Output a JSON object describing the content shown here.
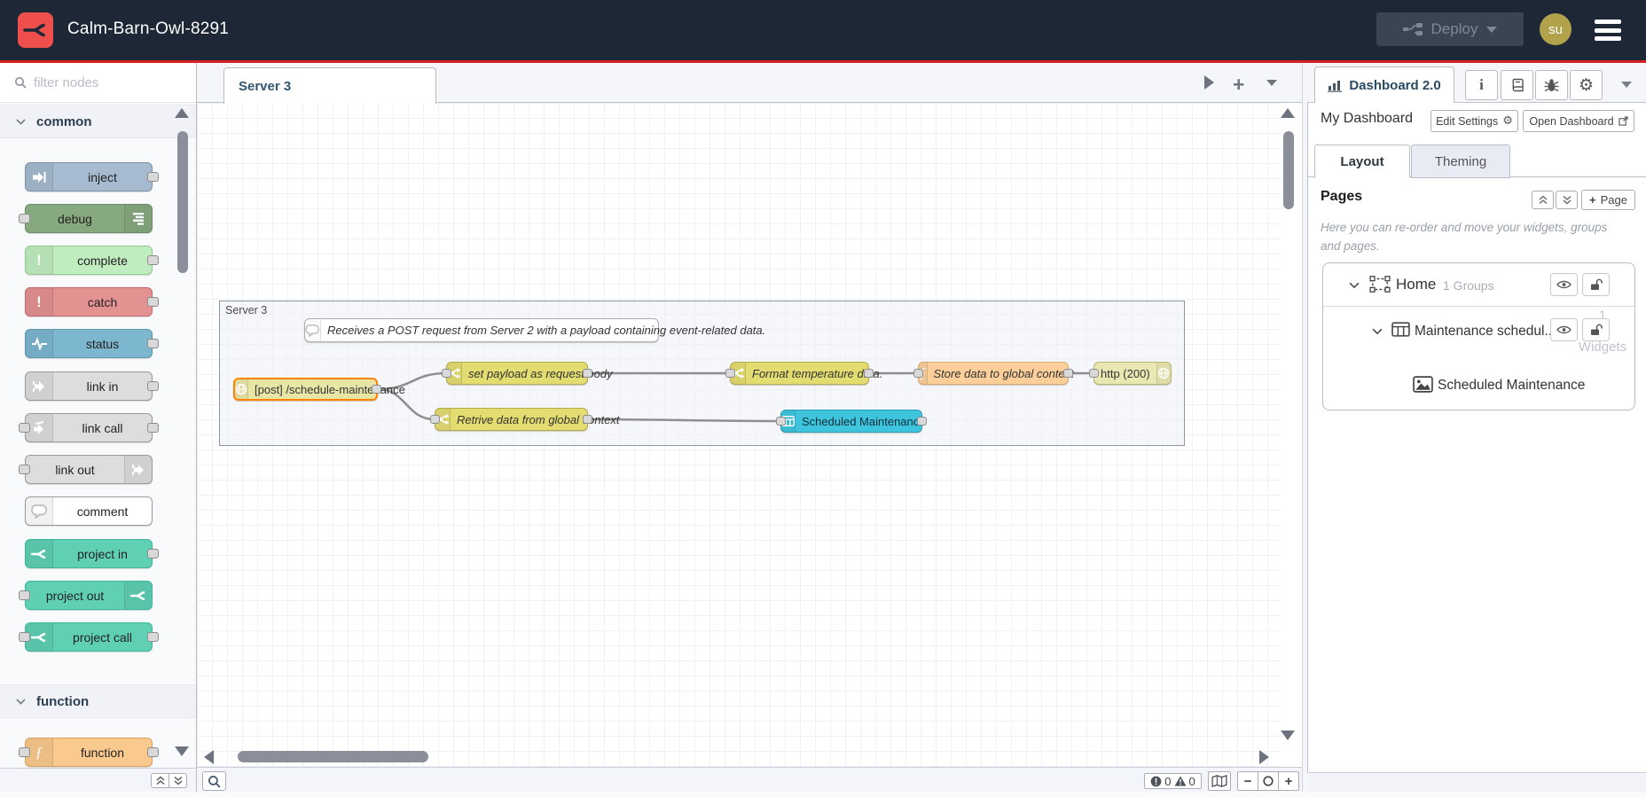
{
  "header": {
    "title": "Calm-Barn-Owl-8291",
    "deploy_label": "Deploy",
    "avatar_initials": "su"
  },
  "palette": {
    "filter_placeholder": "filter nodes",
    "categories": [
      {
        "label": "common",
        "items": [
          {
            "label": "inject",
            "color": "#a6bbcf",
            "icon": "inject-icon",
            "ports": "out"
          },
          {
            "label": "debug",
            "color": "#87a980",
            "icon": "debug-icon",
            "ports": "in"
          },
          {
            "label": "complete",
            "color": "#c0edc0",
            "icon": "exclamation-icon",
            "ports": "out"
          },
          {
            "label": "catch",
            "color": "#e49191",
            "icon": "exclamation-icon",
            "ports": "out"
          },
          {
            "label": "status",
            "color": "#7db7cf",
            "icon": "heartbeat-icon",
            "ports": "out"
          },
          {
            "label": "link in",
            "color": "#dddddd",
            "icon": "link-arrow-icon",
            "ports": "out"
          },
          {
            "label": "link call",
            "color": "#dddddd",
            "icon": "link-call-icon",
            "ports": "in,out"
          },
          {
            "label": "link out",
            "color": "#dddddd",
            "icon": "link-arrow-icon",
            "ports": "in"
          },
          {
            "label": "comment",
            "color": "#ffffff",
            "icon": "speech-bubble-icon",
            "ports": ""
          },
          {
            "label": "project in",
            "color": "#5fd0b4",
            "icon": "flowfuse-icon",
            "ports": "out"
          },
          {
            "label": "project out",
            "color": "#5fd0b4",
            "icon": "flowfuse-icon",
            "ports": "in"
          },
          {
            "label": "project call",
            "color": "#5fd0b4",
            "icon": "flowfuse-icon",
            "ports": "in,out"
          }
        ]
      },
      {
        "label": "function",
        "items": [
          {
            "label": "function",
            "color": "#f9c98e",
            "icon": "function-f-icon",
            "ports": "in,out"
          }
        ]
      }
    ]
  },
  "workspace": {
    "tab_label": "Server 3",
    "group_label": "Server 3",
    "comment_text": "Receives a POST request from Server 2 with a payload containing event-related data.",
    "nodes": [
      {
        "label": "[post] /schedule-maintenance",
        "type": "http in",
        "color": "#e8e6a5",
        "selected": true
      },
      {
        "label": "set payload as request body",
        "type": "change",
        "color": "#e3dc71"
      },
      {
        "label": "Format temperature data.",
        "type": "change",
        "color": "#e3dc71"
      },
      {
        "label": "Store data to global context",
        "type": "function",
        "color": "#fccf9a"
      },
      {
        "label": "http (200)",
        "type": "http response",
        "color": "#eae8b2"
      },
      {
        "label": "Retrive data from global context",
        "type": "change",
        "color": "#e3dc71"
      },
      {
        "label": "Scheduled Maintenance",
        "type": "ui-table",
        "color": "#3fc4de"
      }
    ]
  },
  "sidebar": {
    "tab_label": "Dashboard 2.0",
    "dashboard_title": "My Dashboard",
    "edit_settings_label": "Edit Settings",
    "open_dashboard_label": "Open Dashboard",
    "tabs": [
      "Layout",
      "Theming"
    ],
    "pages_heading": "Pages",
    "add_page_label": "Page",
    "help_text": "Here you can re-order and move your widgets, groups and pages.",
    "tree": {
      "page": {
        "label": "Home",
        "meta": "1 Groups"
      },
      "group": {
        "label": "Maintenance schedul...",
        "meta_line1": "1",
        "meta_line2": "Widgets"
      },
      "widget": {
        "label": "Scheduled Maintenance"
      }
    }
  },
  "statusbar": {
    "errors": "0",
    "warnings": "0"
  },
  "glyphs": {
    "plus": "+",
    "minus": "−",
    "gear": "⚙",
    "info": "i",
    "function_f": "ƒ",
    "bang": "!"
  },
  "colors": {
    "header_bg": "#1d2736",
    "accent_red": "#d42121",
    "logo_red": "#ee4f4d",
    "deploy_bg": "#3a4553",
    "deploy_text": "#7e8894",
    "avatar_bg": "#b2a24c",
    "selected_node_border": "#ff8300",
    "canvas_grid": "#eef1f7",
    "wire": "#8f8f8f"
  }
}
